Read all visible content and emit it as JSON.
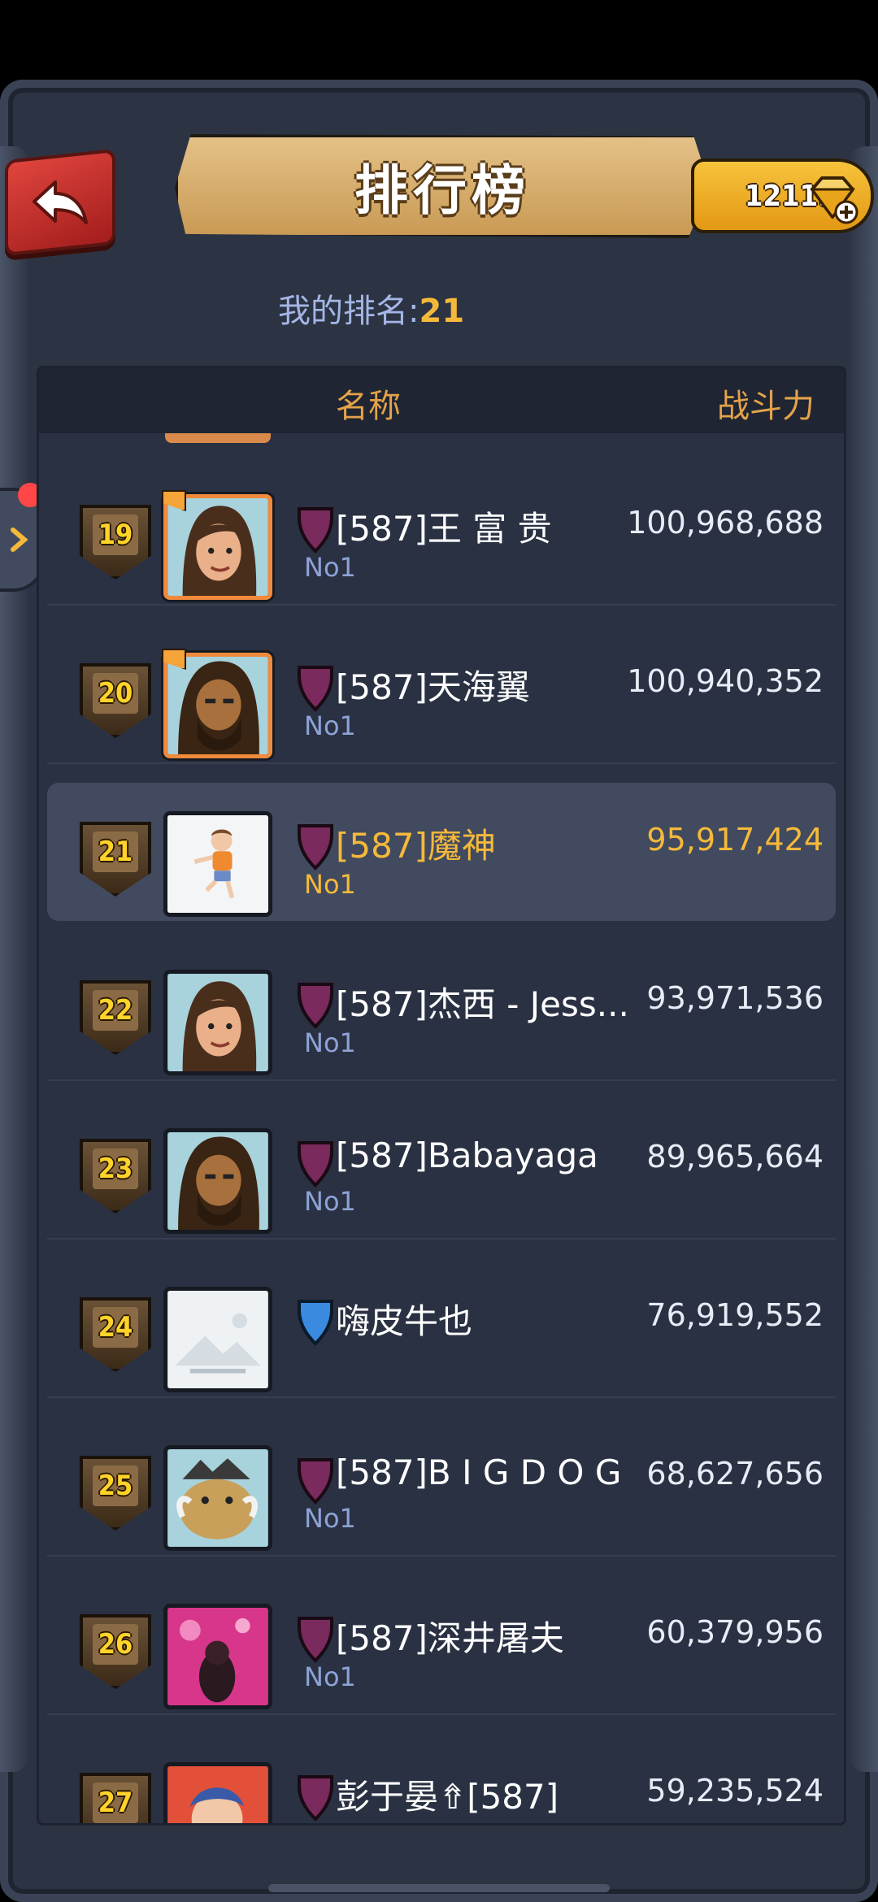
{
  "header": {
    "title": "排行榜",
    "gems": "12119"
  },
  "my_rank": {
    "label": "我的排名:",
    "value": "21"
  },
  "columns": {
    "name": "名称",
    "power": "战斗力"
  },
  "rows": [
    {
      "rank": "19",
      "name": "[587]王 富 贵",
      "sub": "No1",
      "power": "100,968,688",
      "shield": "purple"
    },
    {
      "rank": "20",
      "name": "[587]天海翼",
      "sub": "No1",
      "power": "100,940,352",
      "shield": "purple"
    },
    {
      "rank": "21",
      "name": "[587]魔神",
      "sub": "No1",
      "power": "95,917,424",
      "shield": "purple"
    },
    {
      "rank": "22",
      "name": "[587]杰西 - Jess...",
      "sub": "No1",
      "power": "93,971,536",
      "shield": "purple"
    },
    {
      "rank": "23",
      "name": "[587]Babayaga",
      "sub": "No1",
      "power": "89,965,664",
      "shield": "purple"
    },
    {
      "rank": "24",
      "name": "嗨皮牛也",
      "sub": "",
      "power": "76,919,552",
      "shield": "blue"
    },
    {
      "rank": "25",
      "name": "[587]B I G D O G",
      "sub": "No1",
      "power": "68,627,656",
      "shield": "purple"
    },
    {
      "rank": "26",
      "name": "[587]深井屠夫",
      "sub": "No1",
      "power": "60,379,956",
      "shield": "purple"
    },
    {
      "rank": "27",
      "name": "彭于晏⇮[587]",
      "sub": "",
      "power": "59,235,524",
      "shield": "purple"
    }
  ],
  "colors": {
    "accent_gold": "#f5b93a",
    "header_gold": "#e3a24a",
    "self_row_bg": "#414a5e",
    "sub_text": "#8da3d6",
    "shield_purple": "#7a2a5c",
    "shield_blue": "#3a8ae0"
  }
}
